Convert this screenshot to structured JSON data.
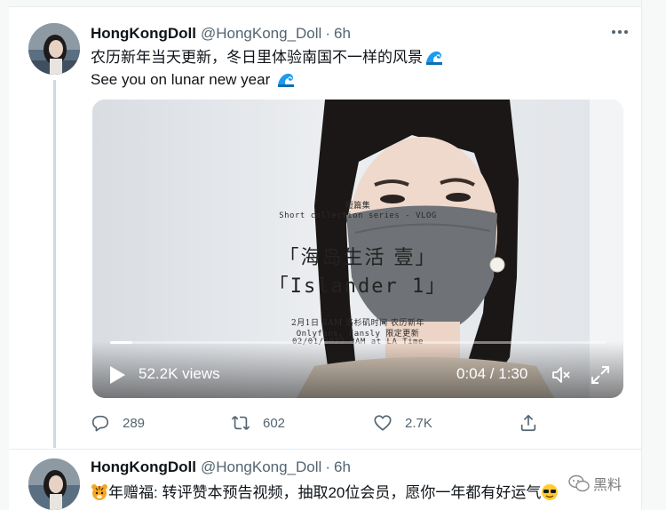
{
  "tweet1": {
    "display_name": "HongKongDoll",
    "handle": "@HongKong_Doll",
    "separator": "·",
    "time": "6h",
    "line1": "农历新年当天更新，冬日里体验南国不一样的风景",
    "line2": "See you on lunar new year ",
    "video": {
      "overlay_label_cn": "短篇集",
      "overlay_series": "Short collection series - VLOG",
      "overlay_title_cn": "「海岛生活 壹」",
      "overlay_title_en": "「Islander 1」",
      "overlay_line1": "2月1日 8AM 洛杉矶时间 农历新年",
      "overlay_line2": "Onlyfans, Fansly 限定更新",
      "overlay_line3": "02/01/2022 8AM at LA Time",
      "views": "52.2K views",
      "time_display": "0:04 / 1:30",
      "progress": 0.045
    },
    "actions": {
      "replies": "289",
      "retweets": "602",
      "likes": "2.7K"
    }
  },
  "tweet2": {
    "display_name": "HongKongDoll",
    "handle": "@HongKong_Doll",
    "separator": "·",
    "time": "6h",
    "text": "年赠福: 转评赞本预告视频，抽取20位会员，愿你一年都有好运气"
  },
  "watermark": "黑料",
  "icons": {
    "more": "more-dots-icon",
    "wave": "wave-emoji-icon",
    "tiger": "tiger-emoji-icon",
    "sunglasses": "sunglasses-emoji-icon",
    "reply": "reply-icon",
    "retweet": "retweet-icon",
    "like": "heart-icon",
    "share": "share-icon",
    "play": "play-icon",
    "mute": "volume-mute-icon",
    "fullscreen": "fullscreen-icon"
  },
  "colors": {
    "text_primary": "#0f1419",
    "text_secondary": "#536471",
    "divider": "#e6ecf0",
    "thread_line": "#cfd9de",
    "wave_blue": "#1d9bf0"
  }
}
